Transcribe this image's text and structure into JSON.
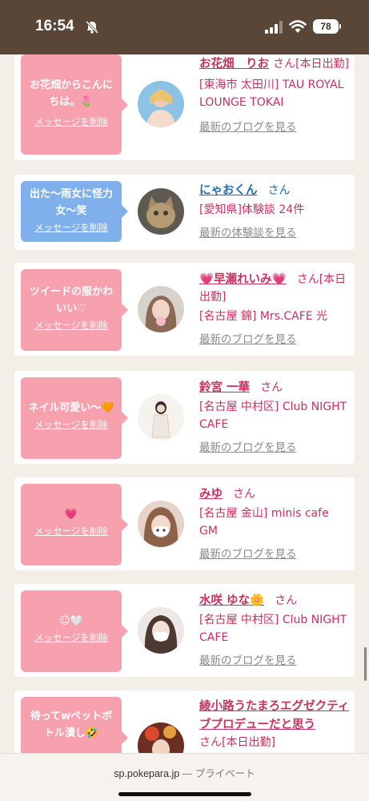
{
  "status": {
    "time": "16:54",
    "battery": "78"
  },
  "items": [
    {
      "message": "お花畑からこんにちは。🌷",
      "delete": "メッセージを削除",
      "name": "お花畑　りお",
      "san": "さん",
      "tag": "[本日出勤]",
      "shop": "[東海市 太田川] TAU ROYAL LOUNGE TOKAI",
      "link": "最新のブログを見る"
    },
    {
      "message": "出た〜雨女に怪力女〜笑",
      "delete": "メッセージを削除",
      "name": "にゃおくん",
      "san": "さん",
      "tag": "",
      "shop": "[愛知県]体験談 24件",
      "link": "最新の体験談を見る"
    },
    {
      "message": "ツイードの服かわいい♡",
      "delete": "メッセージを削除",
      "name": "💗早瀬れいみ💗",
      "san": "さん",
      "tag": "[本日出勤]",
      "shop": "[名古屋 錦] Mrs.CAFE 光",
      "link": "最新のブログを見る"
    },
    {
      "message": "ネイル可愛い〜🧡",
      "delete": "メッセージを削除",
      "name": "鈴宮 一華",
      "san": "さん",
      "tag": "",
      "shop": "[名古屋 中村区] Club NIGHT CAFE",
      "link": "最新のブログを見る"
    },
    {
      "message": "💗",
      "delete": "メッセージを削除",
      "name": "みゆ",
      "san": "さん",
      "tag": "",
      "shop": "[名古屋 金山] minis cafe GM",
      "link": "最新のブログを見る"
    },
    {
      "message": "☺🤍",
      "delete": "メッセージを削除",
      "name": "水咲 ゆな🌼",
      "san": "さん",
      "tag": "",
      "shop": "[名古屋 中村区] Club NIGHT CAFE",
      "link": "最新のブログを見る"
    },
    {
      "message": "待ってwペットボトル潰し🤣",
      "delete": "メッセージを削除",
      "name": "綾小路うたまろエグゼクティブプロデューだと思う",
      "san": "さん",
      "tag": "[本日出勤]",
      "shop": "",
      "link": ""
    }
  ],
  "url_bar": {
    "domain": "sp.pokepara.jp",
    "separator": "—",
    "mode": "プライベート"
  },
  "colors": {
    "status_bar": "#5a4636",
    "bubble_pink": "#f7a1ae",
    "bubble_blue": "#7fb0ec",
    "name_pink": "#c8325e",
    "name_blue": "#1e6fb0"
  }
}
